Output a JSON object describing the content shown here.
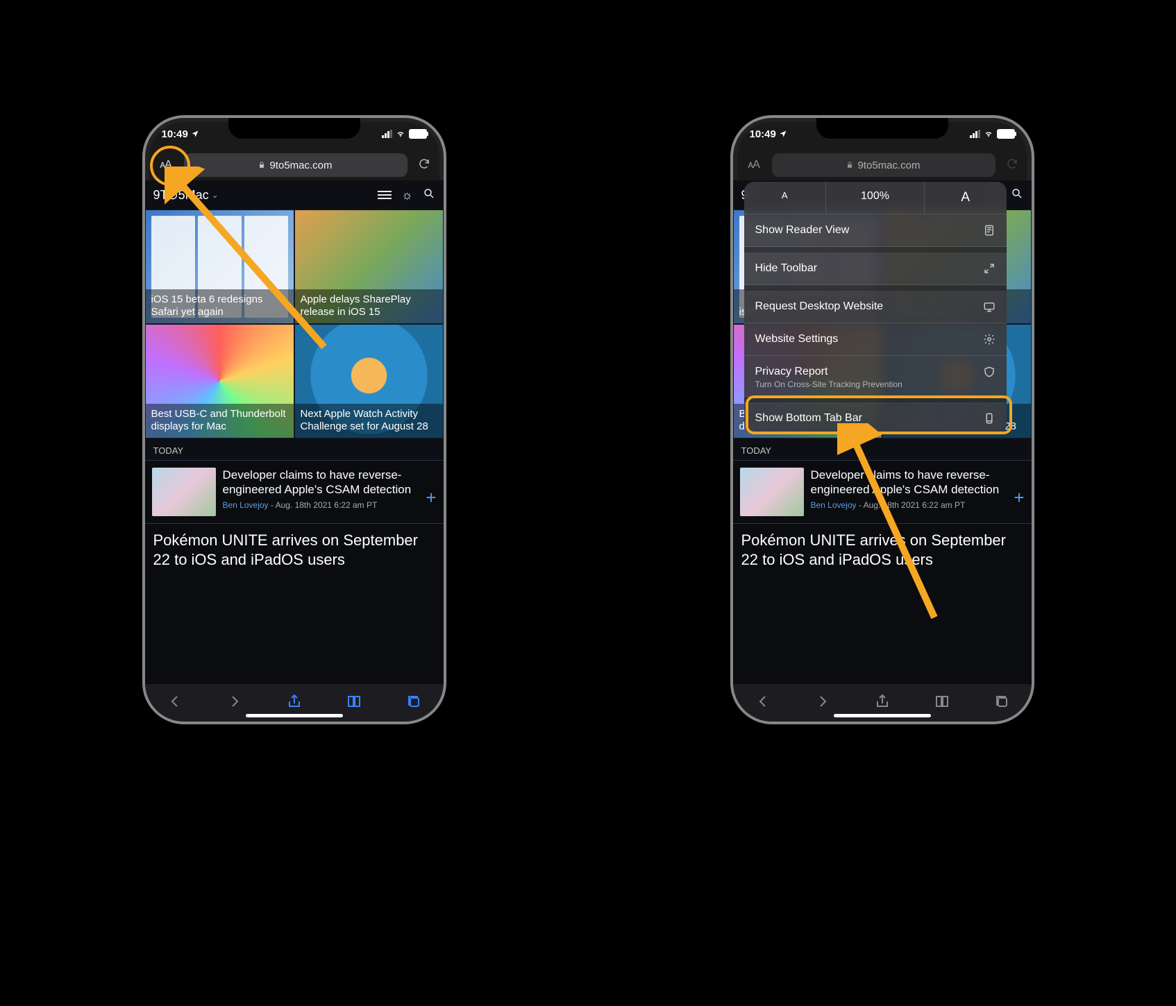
{
  "status": {
    "time": "10:49",
    "location_icon": "location-arrow"
  },
  "address_bar": {
    "aa_label": "ᴀA",
    "domain": "9to5mac.com",
    "reload_icon": "↻"
  },
  "page": {
    "brand": "9T⊙5Mac",
    "brand_chevron": "⌄",
    "icons": {
      "menu": "menu-icon",
      "theme": "sun-icon",
      "search": "search-icon"
    },
    "tiles": [
      {
        "title": "iOS 15 beta 6 redesigns Safari yet again"
      },
      {
        "title": "Apple delays SharePlay release in iOS 15"
      },
      {
        "title": "Best USB-C and Thunderbolt displays for Mac"
      },
      {
        "title": "Next Apple Watch Activity Challenge set for August 28"
      }
    ],
    "section_label": "TODAY",
    "story1": {
      "title": "Developer claims to have reverse-engineered Apple's CSAM detection",
      "author": "Ben Lovejoy",
      "date_sep": " - ",
      "date": "Aug. 18th 2021 6:22 am PT"
    },
    "story2": "Pokémon UNITE arrives on September 22 to iOS and iPadOS users"
  },
  "toolbar": {
    "back": "chevron-left-icon",
    "forward": "chevron-right-icon",
    "share": "share-icon",
    "bookmarks": "book-icon",
    "tabs": "tabs-icon"
  },
  "popover": {
    "zoom_small": "A",
    "zoom_pct": "100%",
    "zoom_large": "A",
    "reader": {
      "label": "Show Reader View"
    },
    "hide_toolbar": {
      "label": "Hide Toolbar"
    },
    "request_desktop": {
      "label": "Request Desktop Website"
    },
    "website_settings": {
      "label": "Website Settings"
    },
    "privacy": {
      "label": "Privacy Report",
      "sub": "Turn On Cross-Site Tracking Prevention"
    },
    "bottom_bar": {
      "label": "Show Bottom Tab Bar"
    }
  },
  "annotations": {
    "circle_on": "aA-button",
    "box_on": "show-bottom-tab-bar-item"
  }
}
